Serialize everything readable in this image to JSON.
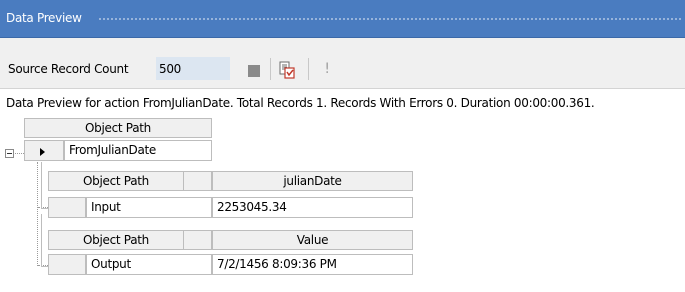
{
  "panel": {
    "title": "Data Preview"
  },
  "toolbar": {
    "source_label": "Source Record Count",
    "source_value": "500",
    "stop_icon": "stop-icon",
    "report_icon": "report-icon",
    "exclamation_icon": "exclamation-icon"
  },
  "status": {
    "text": "Data Preview for action FromJulianDate. Total Records 1. Records With Errors 0. Duration 00:00:00.361."
  },
  "tree": {
    "root": {
      "header": "Object Path",
      "value": "FromJulianDate"
    },
    "children": [
      {
        "headers": [
          "Object Path",
          "julianDate"
        ],
        "cells": [
          "Input",
          "2253045.34"
        ]
      },
      {
        "headers": [
          "Object Path",
          "Value"
        ],
        "cells": [
          "Output",
          "7/2/1456 8:09:36 PM"
        ]
      }
    ]
  },
  "colors": {
    "title_bar": "#4a7cc0",
    "count_field": "#dce6f1",
    "header_bg": "#f0f0f0",
    "grid_border": "#bdbdbd"
  }
}
